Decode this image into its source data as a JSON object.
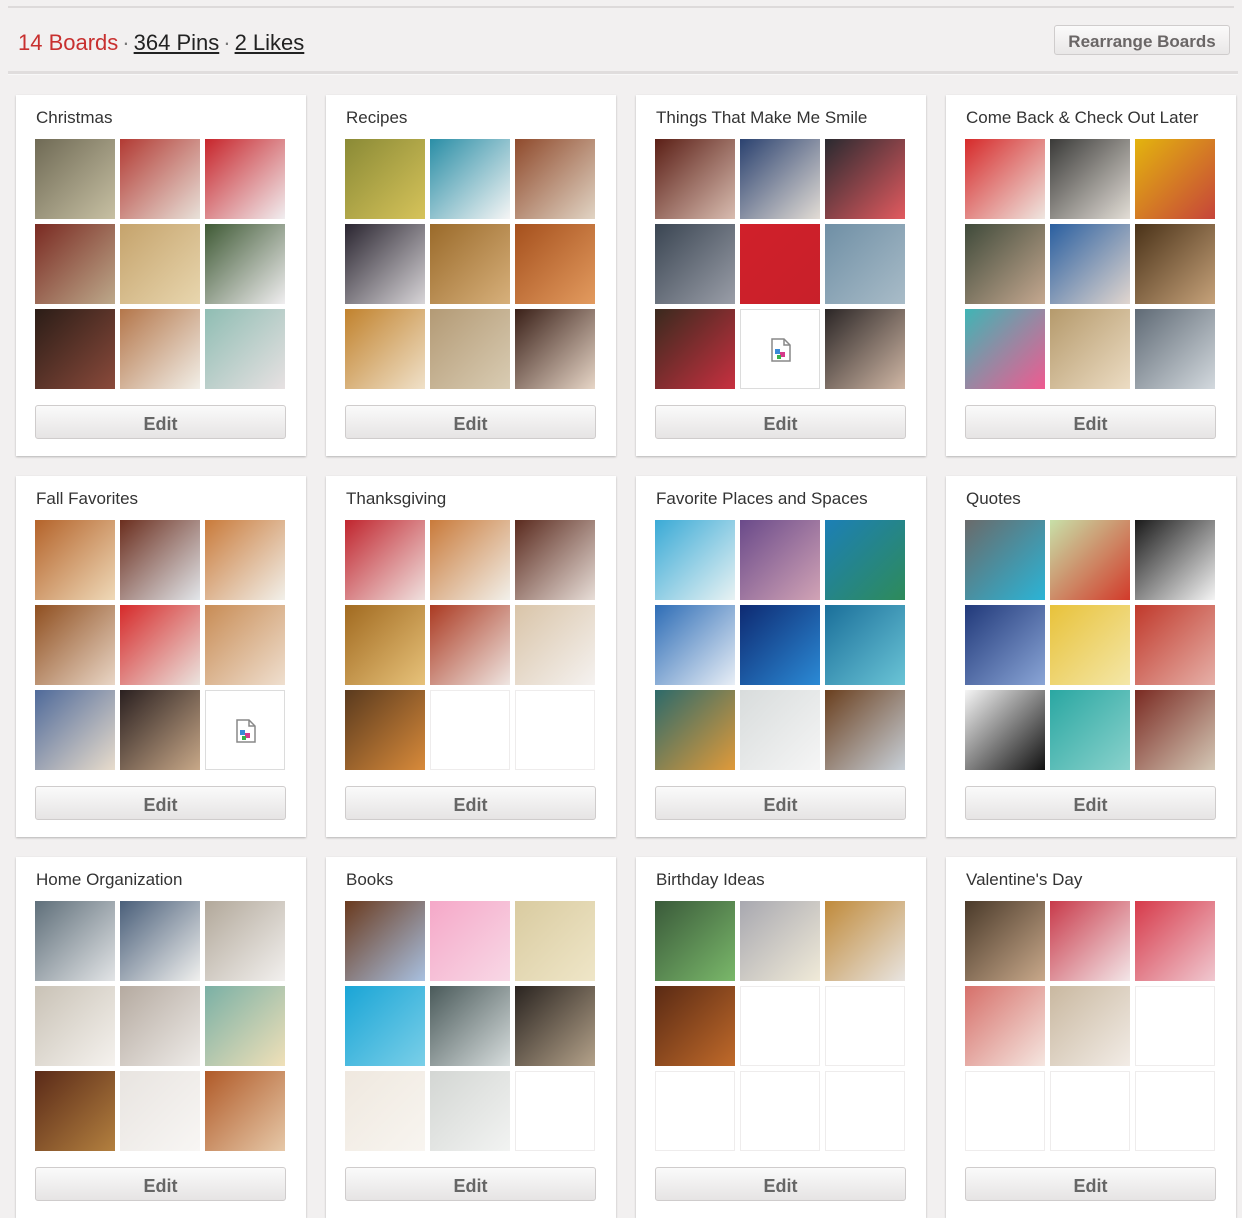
{
  "stats": {
    "boards": "14 Boards",
    "pins": "364 Pins",
    "likes": "2 Likes",
    "separator": "·"
  },
  "rearrange_label": "Rearrange Boards",
  "edit_label": "Edit",
  "colors": {
    "page_bg": "#f2f0f0",
    "board_count": "#c8302f",
    "card_bg": "#ffffff"
  },
  "boards": [
    {
      "title": "Christmas",
      "thumbs": [
        [
          "#6f6a55",
          "#c7c0a3"
        ],
        [
          "#b23a33",
          "#e8e1d9"
        ],
        [
          "#c7252b",
          "#f1eef0"
        ],
        [
          "#7a2a22",
          "#bda98b"
        ],
        [
          "#c5a36c",
          "#e8d6ae"
        ],
        [
          "#3f5a35",
          "#f0eef0"
        ],
        [
          "#2b1d17",
          "#8a4a3b"
        ],
        [
          "#b4764a",
          "#f2efe8"
        ],
        [
          "#8fbdb3",
          "#e7e1e2"
        ]
      ]
    },
    {
      "title": "Recipes",
      "thumbs": [
        [
          "#8a8a36",
          "#d6c35a"
        ],
        [
          "#2a8ea6",
          "#f5f5f5"
        ],
        [
          "#8f4a2c",
          "#e1d4c4"
        ],
        [
          "#2a2530",
          "#d8d5d8"
        ],
        [
          "#9a6a2a",
          "#d7b07b"
        ],
        [
          "#a5501d",
          "#e39b5f"
        ],
        [
          "#c1822d",
          "#f0e1c9"
        ],
        [
          "#b39a75",
          "#d9ccb3"
        ],
        [
          "#3a2018",
          "#e7d6c7"
        ]
      ]
    },
    {
      "title": "Things That Make Me Smile",
      "thumbs": [
        [
          "#5b1f16",
          "#d8bcb0"
        ],
        [
          "#2b4270",
          "#e2dcd5"
        ],
        [
          "#2a2a30",
          "#e25a5f"
        ],
        [
          "#3a4552",
          "#9a9ea8"
        ],
        [
          "#d0202a",
          "#c8202a"
        ],
        [
          "#6f8fa5",
          "#a9bcc8"
        ],
        [
          "#3a2a1e",
          "#c83040"
        ],
        {
          "broken": true
        },
        [
          "#2b2626",
          "#d0b7a5"
        ]
      ]
    },
    {
      "title": "Come Back & Check Out Later",
      "thumbs": [
        [
          "#d62a2a",
          "#efe6e0"
        ],
        [
          "#3a3a38",
          "#e2ddd6"
        ],
        [
          "#e3b40e",
          "#c6443a"
        ],
        [
          "#3f4a3a",
          "#c5a890"
        ],
        [
          "#2a5fa0",
          "#e1d6cf"
        ],
        [
          "#4a3218",
          "#c6a27a"
        ],
        [
          "#3fb5b5",
          "#f05a90"
        ],
        [
          "#b59a6c",
          "#ecdcc3"
        ],
        [
          "#5f6a75",
          "#d3d9de"
        ]
      ]
    },
    {
      "title": "Fall Favorites",
      "thumbs": [
        [
          "#b4632a",
          "#efd9b8"
        ],
        [
          "#6b2e1e",
          "#e2e6ea"
        ],
        [
          "#c97a3a",
          "#f2f0ea"
        ],
        [
          "#8f4f20",
          "#e9d6c6"
        ],
        [
          "#d62a2a",
          "#ebe4df"
        ],
        [
          "#c88c55",
          "#efdfcf"
        ],
        [
          "#4f6a9a",
          "#e8dccc"
        ],
        [
          "#2a2020",
          "#c8a888"
        ],
        {
          "broken": true
        }
      ]
    },
    {
      "title": "Thanksgiving",
      "thumbs": [
        [
          "#c0252e",
          "#f0e1df"
        ],
        [
          "#c97a3a",
          "#f2f0ea"
        ],
        [
          "#5a2a1e",
          "#e8ded8"
        ],
        [
          "#a16a20",
          "#e7c27a"
        ],
        [
          "#ab3a22",
          "#efe6e2"
        ],
        [
          "#d9c4a8",
          "#f5f2f0"
        ],
        [
          "#5a3a1e",
          "#d88a3a"
        ],
        {
          "empty": true
        },
        {
          "empty": true
        }
      ]
    },
    {
      "title": "Favorite Places and Spaces",
      "thumbs": [
        [
          "#3aaad6",
          "#e8f2f3"
        ],
        [
          "#6a4a8a",
          "#d1a3b5"
        ],
        [
          "#1c7fb6",
          "#2e8b5a"
        ],
        [
          "#2e6db6",
          "#e8eef6"
        ],
        [
          "#0e2a72",
          "#2b8ad5"
        ],
        [
          "#1a6f9a",
          "#6ac4d6"
        ],
        [
          "#2d6a6a",
          "#e09a3a"
        ],
        [
          "#d8dcdc",
          "#f5f5f5"
        ],
        [
          "#6a3f1e",
          "#c8d0d8"
        ]
      ]
    },
    {
      "title": "Quotes",
      "thumbs": [
        [
          "#6a6a6a",
          "#2bb4d6"
        ],
        [
          "#c8e0a8",
          "#d23a2a"
        ],
        [
          "#1a1a1a",
          "#f5f5f5"
        ],
        [
          "#21397a",
          "#8aa5d6"
        ],
        [
          "#e8c23a",
          "#f4e7a8"
        ],
        [
          "#c0392b",
          "#e6b0a8"
        ],
        [
          "#f5f5f5",
          "#111111"
        ],
        [
          "#2aa7a2",
          "#8ad2cc"
        ],
        [
          "#7a2a22",
          "#d4c8b6"
        ]
      ]
    },
    {
      "title": "Home Organization",
      "thumbs": [
        [
          "#5f6f7a",
          "#e2e4e6"
        ],
        [
          "#4a5f7a",
          "#f0f0ee"
        ],
        [
          "#b2a89a",
          "#f2f0ee"
        ],
        [
          "#c9c2b6",
          "#f5f2ee"
        ],
        [
          "#b5aaa0",
          "#eeebe8"
        ],
        [
          "#7ab0a5",
          "#f0e0b8"
        ],
        [
          "#5a2a18",
          "#b3803f"
        ],
        [
          "#e8e4e0",
          "#f8f6f4"
        ],
        [
          "#b05a28",
          "#e6c8a8"
        ]
      ]
    },
    {
      "title": "Books",
      "thumbs": [
        [
          "#6a3a1e",
          "#a8c0e0"
        ],
        [
          "#f5a8c8",
          "#f8d8e6"
        ],
        [
          "#d9cba0",
          "#efe6c8"
        ],
        [
          "#1aa5d6",
          "#7acfe8"
        ],
        [
          "#4a5a5a",
          "#d7dddd"
        ],
        [
          "#2a2420",
          "#b4a28a"
        ],
        [
          "#efe8df",
          "#f8f5f0"
        ],
        [
          "#d3d6d3",
          "#f2f3f2"
        ],
        {
          "empty": true
        }
      ]
    },
    {
      "title": "Birthday Ideas",
      "thumbs": [
        [
          "#3a5a3a",
          "#7ab86a"
        ],
        [
          "#a8a8b0",
          "#f0ead8"
        ],
        [
          "#c08a3a",
          "#e8e4e0"
        ],
        [
          "#5a2a14",
          "#c06a2a"
        ],
        {
          "empty": true
        },
        {
          "empty": true
        },
        {
          "empty": true
        },
        {
          "empty": true
        },
        {
          "empty": true
        }
      ]
    },
    {
      "title": "Valentine's Day",
      "thumbs": [
        [
          "#4a3a2a",
          "#c8a88a"
        ],
        [
          "#c83a4a",
          "#f3e6e8"
        ],
        [
          "#d63a4a",
          "#f0c8d0"
        ],
        [
          "#d6706a",
          "#f5e6e0"
        ],
        [
          "#c9b8a0",
          "#f2ece6"
        ],
        {
          "empty": true
        },
        {
          "empty": true
        },
        {
          "empty": true
        },
        {
          "empty": true
        }
      ]
    }
  ]
}
